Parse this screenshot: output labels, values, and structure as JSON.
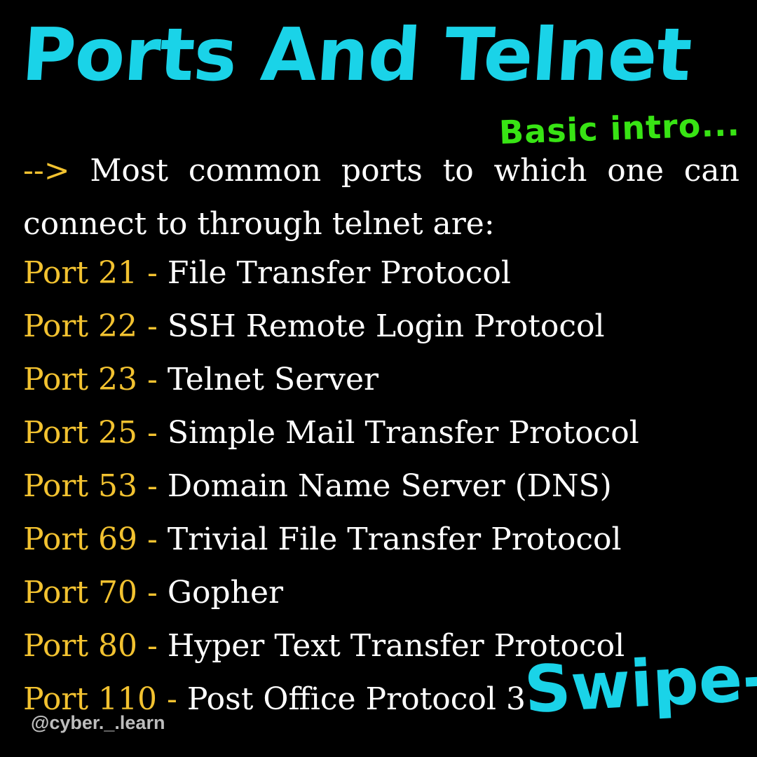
{
  "colors": {
    "background": "#000000",
    "title": "#1ad3e8",
    "subtitle": "#38e414",
    "accent": "#f2c230",
    "text": "#ffffff",
    "handle": "#bdbdbd"
  },
  "header": {
    "title": "Ports And Telnet",
    "subtitle": "Basic intro..."
  },
  "intro": {
    "arrow": "-->",
    "text": "Most common ports to which one can connect to through telnet are:"
  },
  "ports": [
    {
      "label": "Port 21 -",
      "service": "File Transfer Protocol"
    },
    {
      "label": "Port 22 -",
      "service": "SSH Remote Login Protocol"
    },
    {
      "label": "Port 23 -",
      "service": "Telnet Server"
    },
    {
      "label": "Port 25 -",
      "service": "Simple Mail Transfer Protocol"
    },
    {
      "label": "Port 53 -",
      "service": "Domain Name Server (DNS)"
    },
    {
      "label": "Port 69 -",
      "service": "Trivial File Transfer Protocol"
    },
    {
      "label": "Port 70 -",
      "service": "Gopher"
    },
    {
      "label": "Port 80 -",
      "service": "Hyper Text Transfer Protocol"
    },
    {
      "label": "Port 110 -",
      "service": "Post Office Protocol 3"
    }
  ],
  "footer": {
    "swipe": "Swipe->",
    "handle": "@cyber._.learn"
  }
}
